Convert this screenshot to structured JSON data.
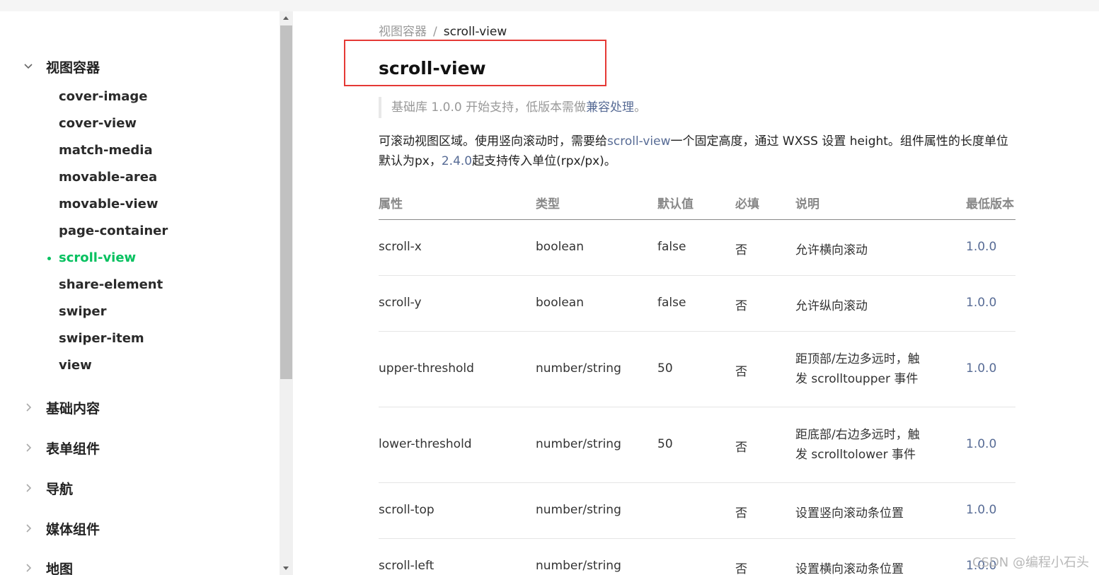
{
  "sidebar": {
    "groups": [
      {
        "label": "视图容器",
        "expanded": true
      },
      {
        "label": "基础内容",
        "expanded": false
      },
      {
        "label": "表单组件",
        "expanded": false
      },
      {
        "label": "导航",
        "expanded": false
      },
      {
        "label": "媒体组件",
        "expanded": false
      },
      {
        "label": "地图",
        "expanded": false
      }
    ],
    "items": [
      {
        "label": "cover-image"
      },
      {
        "label": "cover-view"
      },
      {
        "label": "match-media"
      },
      {
        "label": "movable-area"
      },
      {
        "label": "movable-view"
      },
      {
        "label": "page-container"
      },
      {
        "label": "scroll-view",
        "active": true
      },
      {
        "label": "share-element"
      },
      {
        "label": "swiper"
      },
      {
        "label": "swiper-item"
      },
      {
        "label": "view"
      }
    ]
  },
  "breadcrumb": {
    "parent": "视图容器",
    "separator": "/",
    "current": "scroll-view"
  },
  "page": {
    "title": "scroll-view",
    "note_prefix": "基础库 1.0.0 开始支持，低版本需做",
    "note_link": "兼容处理",
    "note_suffix": "。",
    "desc_part1": "可滚动视图区域。使用竖向滚动时，需要给",
    "desc_link1": "scroll-view",
    "desc_part2": "一个固定高度，通过 WXSS 设置 height。组件属性的长度单位默认为px，",
    "desc_link2": "2.4.0",
    "desc_part3": "起支持传入单位(rpx/px)。"
  },
  "table": {
    "headers": [
      "属性",
      "类型",
      "默认值",
      "必填",
      "说明",
      "最低版本"
    ],
    "rows": [
      [
        "scroll-x",
        "boolean",
        "false",
        "否",
        "允许横向滚动",
        "1.0.0"
      ],
      [
        "scroll-y",
        "boolean",
        "false",
        "否",
        "允许纵向滚动",
        "1.0.0"
      ],
      [
        "upper-threshold",
        "number/string",
        "50",
        "否",
        "距顶部/左边多远时，触发 scrolltoupper 事件",
        "1.0.0"
      ],
      [
        "lower-threshold",
        "number/string",
        "50",
        "否",
        "距底部/右边多远时，触发 scrolltolower 事件",
        "1.0.0"
      ],
      [
        "scroll-top",
        "number/string",
        "",
        "否",
        "设置竖向滚动条位置",
        "1.0.0"
      ],
      [
        "scroll-left",
        "number/string",
        "",
        "否",
        "设置横向滚动条位置",
        "1.0.0"
      ]
    ]
  },
  "colors": {
    "accent_green": "#07c160",
    "link_blue": "#576b95",
    "highlight_red": "#e53935"
  },
  "watermark": "CSDN @编程小石头"
}
